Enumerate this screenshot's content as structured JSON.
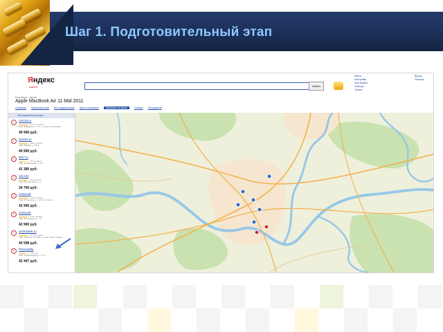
{
  "slide": {
    "title": "Шаг 1. Подготовительный этап",
    "colors": {
      "band": "#1c2f57",
      "title": "#8ec8ff",
      "checker_light": "#f4f4f4",
      "checker_green": "#eef5dc",
      "checker_yellow": "#fff8df"
    }
  },
  "browser": {
    "logo_red": "Я",
    "logo_black": "ндекс",
    "logo_sub": "маркет",
    "nav_tabs": [
      "Поиск",
      "Почта",
      "Карты",
      "Маркет",
      "Новости",
      "Словари",
      "Блоги",
      "Видео",
      "Картинки",
      "ещё"
    ],
    "current_tab": "Маркет",
    "search_value": "",
    "find_button": "Найти",
    "right_links": [
      "Войти",
      "Настройки",
      "Мой Маркет",
      "Помощь",
      "Yandex"
    ],
    "right_links2": [
      "Выход",
      "Помощь"
    ]
  },
  "page": {
    "breadcrumb": "Ноутбуки › Apple",
    "product_title": "Apple MacBook Air 11 Mid 2011",
    "tabs": [
      "Описание",
      "Характеристики",
      "Все модификации",
      "Цены и магазины",
      "Магазины на карте",
      "Отзывы",
      "Обсуждения"
    ],
    "active_tab": "Магазины на карте",
    "list_header": "Все магазины на карте"
  },
  "results": [
    {
      "n": "1",
      "shop": "OZON.ru",
      "stars": "★★★★☆",
      "reviews": "1012 отзывов",
      "address": "Уфа, Комарова, д. 7/7, ст. метро Кольцевая",
      "price": "49 990 руб."
    },
    {
      "n": "2",
      "shop": "ODON.ru",
      "stars": "★★★★☆",
      "reviews": "388 отзывов",
      "address": "Уфа, Ленина, д. 63/1",
      "price": "49 990 руб."
    },
    {
      "n": "3",
      "shop": "RBT.ru",
      "stars": "★★☆☆☆",
      "reviews": "25 отзывов",
      "address": "Уфа, Менделеева, д. 137",
      "price": "41 380 руб."
    },
    {
      "n": "4",
      "shop": "Citi-HD",
      "stars": "★★★★☆",
      "reviews": "20 отзывов",
      "address": "Уфа, Пр. Октября, д. 4",
      "price": "34 790 руб."
    },
    {
      "n": "5",
      "shop": "Связной",
      "stars": "★★★★☆",
      "reviews": "105 отзывов",
      "address": "Уфа, Кольцевая ул., д.60, ст. метро",
      "price": "42 990 руб."
    },
    {
      "n": "6",
      "shop": "Связной",
      "stars": "★★★★☆",
      "reviews": "105 отзывов",
      "address": "Уфа, Кольцевая ул., ТЦ",
      "price": "42 990 руб."
    },
    {
      "n": "7",
      "shop": "Sotmarket.ru",
      "stars": "★★★★☆",
      "reviews": "4170 отзывов",
      "address": "Уфа, проспект Октября, д. 24А, пункт выдачи",
      "price": "40 598 руб."
    },
    {
      "n": "8",
      "shop": "Planeta8tp",
      "stars": "★★★☆☆",
      "reviews": "1 отзыв",
      "address": "Уфа, Гражданская ул., д. 17",
      "price": "42 447 руб."
    }
  ],
  "map": {
    "markers": [
      "1",
      "2",
      "3",
      "4",
      "5",
      "6",
      "7",
      "8"
    ],
    "colors": {
      "land": "#eef0dc",
      "forest": "#c9e2b0",
      "water": "#98c8e6",
      "city": "#f6e6cf",
      "road": "#f2b14d",
      "marker": "#2f6fc2"
    }
  }
}
